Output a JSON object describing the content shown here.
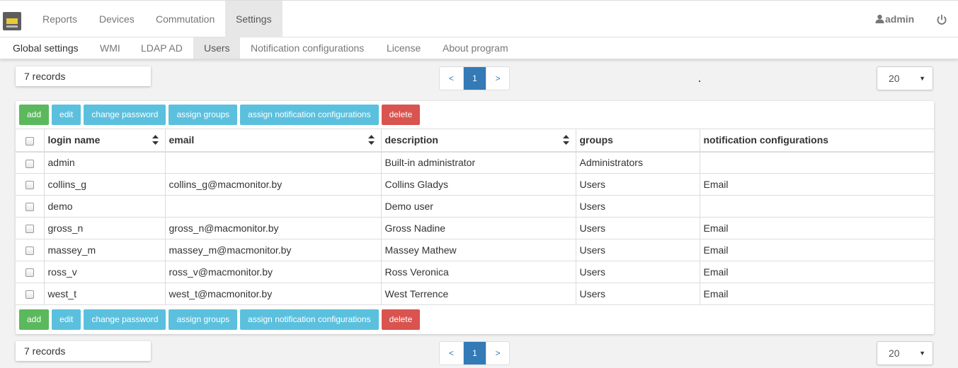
{
  "topnav": {
    "logo": "network-switch-icon",
    "items": [
      "Reports",
      "Devices",
      "Commutation",
      "Settings"
    ],
    "active": "Settings",
    "user": "admin",
    "user_icon": "user-icon",
    "logout_icon": "power-icon"
  },
  "subnav": {
    "items": [
      "Global settings",
      "WMI",
      "LDAP AD",
      "Users",
      "Notification configurations",
      "License",
      "About program"
    ],
    "active": "Users"
  },
  "top": {
    "records": "7 records",
    "pager": {
      "prev": "<",
      "current": "1",
      "next": ">"
    },
    "page_size": "20"
  },
  "toolbar": {
    "add": "add",
    "edit": "edit",
    "change_password": "change password",
    "assign_groups": "assign groups",
    "assign_notifications": "assign notification configurations",
    "delete": "delete"
  },
  "table": {
    "headers": [
      "login name",
      "email",
      "description",
      "groups",
      "notification configurations"
    ],
    "rows": [
      [
        "admin",
        "",
        "Built-in administrator",
        "Administrators",
        ""
      ],
      [
        "collins_g",
        "collins_g@macmonitor.by",
        "Collins Gladys",
        "Users",
        "Email"
      ],
      [
        "demo",
        "",
        "Demo user",
        "Users",
        ""
      ],
      [
        "gross_n",
        "gross_n@macmonitor.by",
        "Gross Nadine",
        "Users",
        "Email"
      ],
      [
        "massey_m",
        "massey_m@macmonitor.by",
        "Massey Mathew",
        "Users",
        "Email"
      ],
      [
        "ross_v",
        "ross_v@macmonitor.by",
        "Ross Veronica",
        "Users",
        "Email"
      ],
      [
        "west_t",
        "west_t@macmonitor.by",
        "West Terrence",
        "Users",
        "Email"
      ]
    ]
  },
  "bottom": {
    "records": "7 records",
    "pager": {
      "prev": "<",
      "current": "1",
      "next": ">"
    },
    "page_size": "20"
  },
  "colors": {
    "add": "#5cb85c",
    "info": "#5bc0de",
    "delete": "#d9534f",
    "pager_active": "#337ab7"
  }
}
